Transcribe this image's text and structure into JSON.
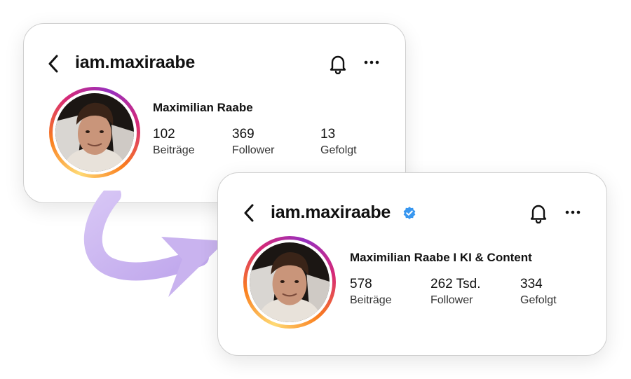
{
  "before": {
    "username": "iam.maxiraabe",
    "full_name": "Maximilian Raabe",
    "stats": [
      {
        "value": "102",
        "label": "Beiträge"
      },
      {
        "value": "369",
        "label": "Follower"
      },
      {
        "value": "13",
        "label": "Gefolgt"
      }
    ],
    "icons": {
      "back": "chevron-left-icon",
      "notifications": "bell-icon",
      "more": "more-horizontal-icon"
    }
  },
  "after": {
    "username": "iam.maxiraabe",
    "verified": true,
    "full_name": "Maximilian Raabe I KI & Content",
    "stats": [
      {
        "value": "578",
        "label": "Beiträge"
      },
      {
        "value": "262 Tsd.",
        "label": "Follower"
      },
      {
        "value": "334",
        "label": "Gefolgt"
      }
    ],
    "icons": {
      "back": "chevron-left-icon",
      "notifications": "bell-icon",
      "more": "more-horizontal-icon",
      "verified": "verified-badge-icon"
    }
  },
  "colors": {
    "verified_badge": "#3897f0",
    "arrow": "#c9b3ef",
    "story_ring": [
      "#feda75",
      "#fa7e1e",
      "#d62976",
      "#962fbf"
    ]
  }
}
